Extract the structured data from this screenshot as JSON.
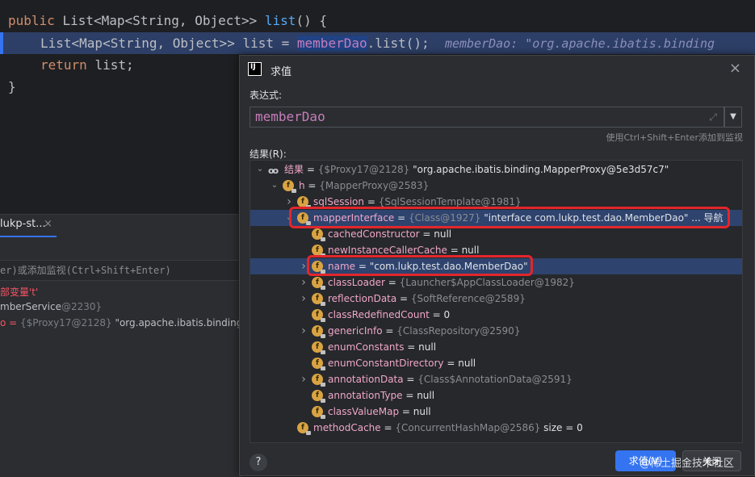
{
  "editor": {
    "line1": {
      "kw": "public",
      "type": "List<Map<String, Object>>",
      "method": "list",
      "rest": "() {"
    },
    "line2": {
      "type": "List<Map<String, Object>>",
      "var": "list =",
      "field": "memberDao",
      "call": ".list();",
      "hint": "memberDao: \"org.apache.ibatis.binding"
    },
    "line3": {
      "kw": "return",
      "rest": "list;"
    },
    "line4": "}"
  },
  "debug_panel": {
    "tab_label": "lukp-st...",
    "tab_close": "×",
    "eval_placeholder": "er)或添加监视(Ctrl+Shift+Enter)",
    "vars": [
      {
        "text": "部变量't'",
        "color": "red"
      },
      {
        "name": "mberService",
        "value": "@2230}"
      },
      {
        "name": "o = ",
        "type": "{$Proxy17@2128}",
        "value": " \"org.apache.ibatis.binding.M"
      }
    ]
  },
  "dialog": {
    "title": "求值",
    "close": "×",
    "expression_label": "表达式:",
    "expression_value": "memberDao",
    "hint": "使用Ctrl+Shift+Enter添加到监视",
    "result_label": "结果(R):",
    "help": "?",
    "evaluate_button": "求值(V)",
    "close_button": "关闭",
    "tree": [
      {
        "depth": 0,
        "arrow": "down",
        "icon": "oo",
        "name": "结果",
        "type": "{$Proxy17@2128}",
        "value": " \"org.apache.ibatis.binding.MapperProxy@5e3d57c7\""
      },
      {
        "depth": 1,
        "arrow": "down",
        "icon": "f",
        "name": "h",
        "type": "{MapperProxy@2583}",
        "value": ""
      },
      {
        "depth": 2,
        "arrow": "right",
        "icon": "f",
        "name": "sqlSession",
        "type": "{SqlSessionTemplate@1981}",
        "value": ""
      },
      {
        "depth": 2,
        "arrow": "down",
        "icon": "f",
        "name": "mapperInterface",
        "type": "{Class@1927}",
        "value": " \"interface com.lukp.test.dao.MemberDao\"",
        "link": "... 导航",
        "selected": true
      },
      {
        "depth": 3,
        "arrow": "",
        "icon": "f",
        "name": "cachedConstructor",
        "type": "",
        "value": "null"
      },
      {
        "depth": 3,
        "arrow": "",
        "icon": "f",
        "name": "newInstanceCallerCache",
        "type": "",
        "value": "null"
      },
      {
        "depth": 3,
        "arrow": "right",
        "icon": "f",
        "name": "name",
        "type": "",
        "value": "\"com.lukp.test.dao.MemberDao\"",
        "selected": true
      },
      {
        "depth": 3,
        "arrow": "right",
        "icon": "f",
        "name": "classLoader",
        "type": "{Launcher$AppClassLoader@1982}",
        "value": ""
      },
      {
        "depth": 3,
        "arrow": "right",
        "icon": "f",
        "name": "reflectionData",
        "type": "{SoftReference@2589}",
        "value": ""
      },
      {
        "depth": 3,
        "arrow": "",
        "icon": "f",
        "name": "classRedefinedCount",
        "type": "",
        "value": "0"
      },
      {
        "depth": 3,
        "arrow": "right",
        "icon": "f",
        "name": "genericInfo",
        "type": "{ClassRepository@2590}",
        "value": ""
      },
      {
        "depth": 3,
        "arrow": "",
        "icon": "f",
        "name": "enumConstants",
        "type": "",
        "value": "null"
      },
      {
        "depth": 3,
        "arrow": "",
        "icon": "f",
        "name": "enumConstantDirectory",
        "type": "",
        "value": "null"
      },
      {
        "depth": 3,
        "arrow": "right",
        "icon": "f",
        "name": "annotationData",
        "type": "{Class$AnnotationData@2591}",
        "value": ""
      },
      {
        "depth": 3,
        "arrow": "",
        "icon": "f",
        "name": "annotationType",
        "type": "",
        "value": "null"
      },
      {
        "depth": 3,
        "arrow": "",
        "icon": "f",
        "name": "classValueMap",
        "type": "",
        "value": "null"
      },
      {
        "depth": 2,
        "arrow": "",
        "icon": "f",
        "name": "methodCache",
        "type": "{ConcurrentHashMap@2586}",
        "value": "  size = 0"
      }
    ]
  },
  "watermark": "@稀土掘金技术社区",
  "colors": {
    "accent": "#3574f0",
    "highlight_box": "#e3262c",
    "field_icon": "#d9a343"
  }
}
